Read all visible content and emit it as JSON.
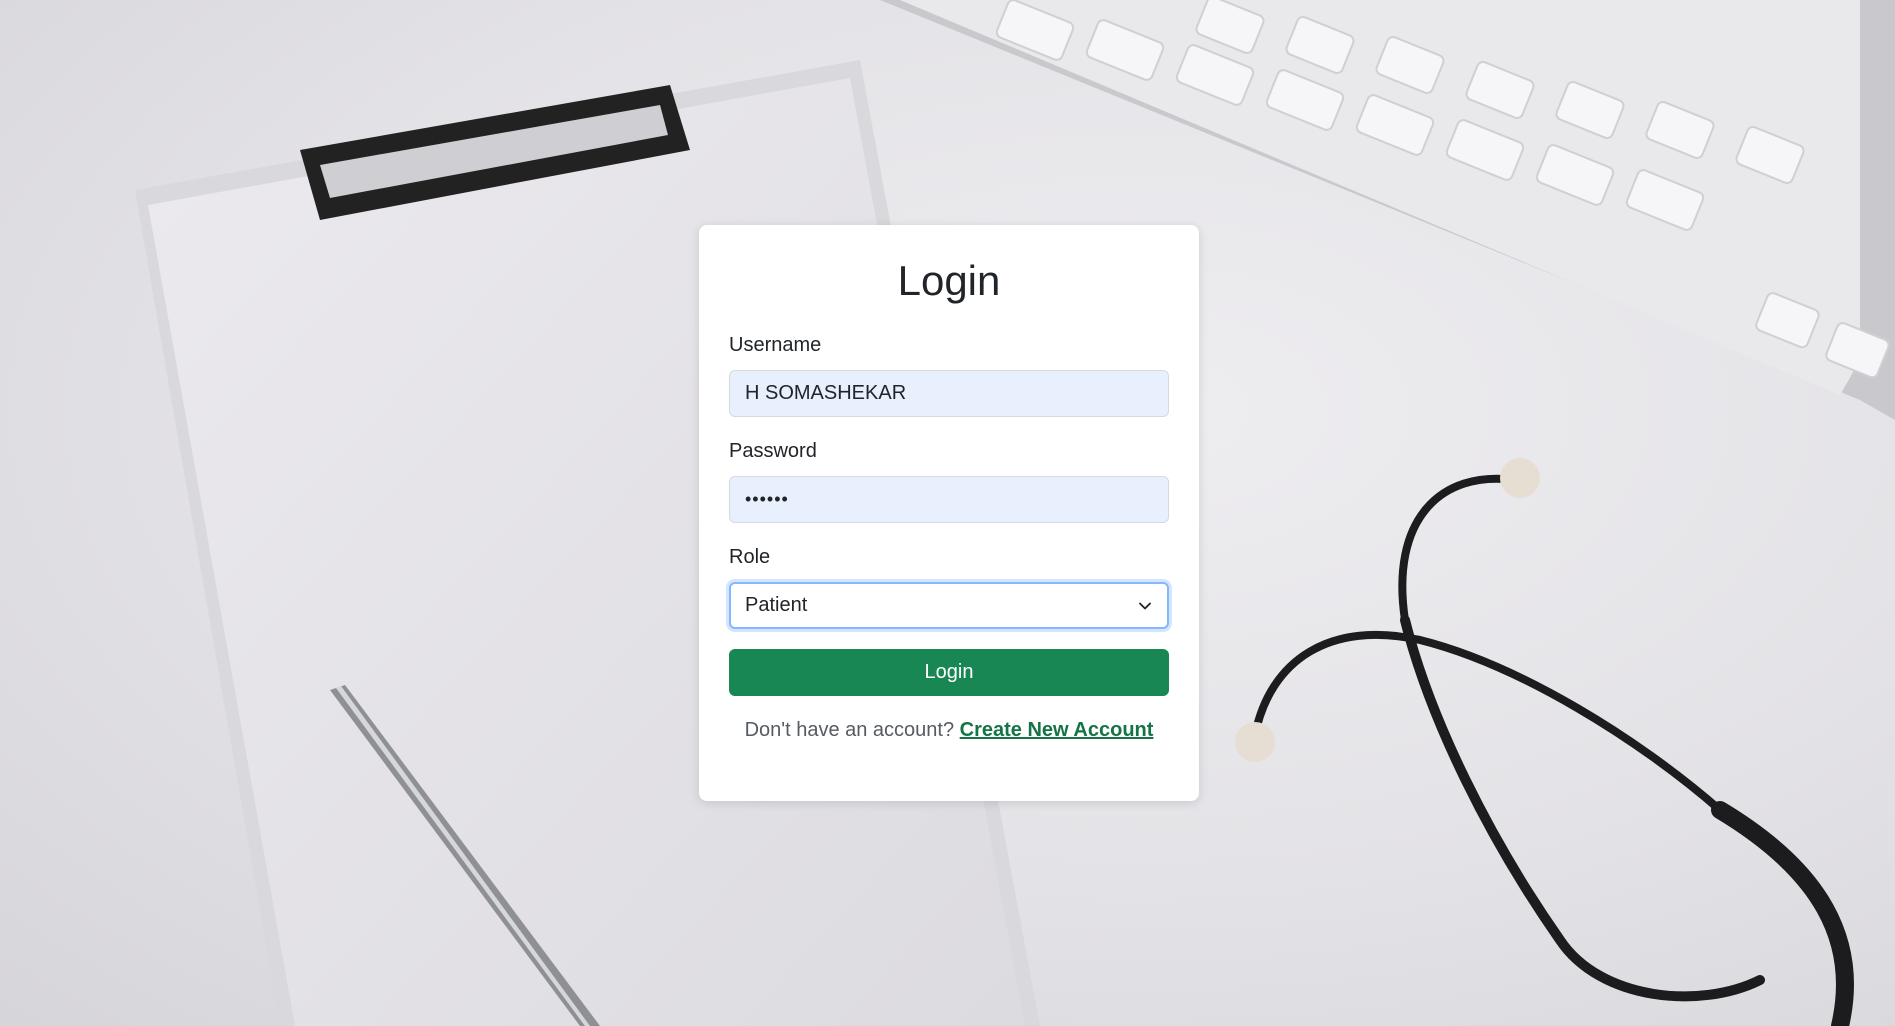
{
  "login": {
    "title": "Login",
    "username": {
      "label": "Username",
      "value": "H SOMASHEKAR"
    },
    "password": {
      "label": "Password",
      "masked_value": "••••••"
    },
    "role": {
      "label": "Role",
      "selected": "Patient"
    },
    "submit_label": "Login",
    "signup_prompt": "Don't have an account?",
    "signup_link": "Create New Account"
  },
  "colors": {
    "primary_button": "#198754",
    "link": "#157347",
    "autofill_input_bg": "#e8f0fe",
    "focus_ring": "#86b7fe"
  },
  "icons": [
    "chevron-down-icon"
  ]
}
